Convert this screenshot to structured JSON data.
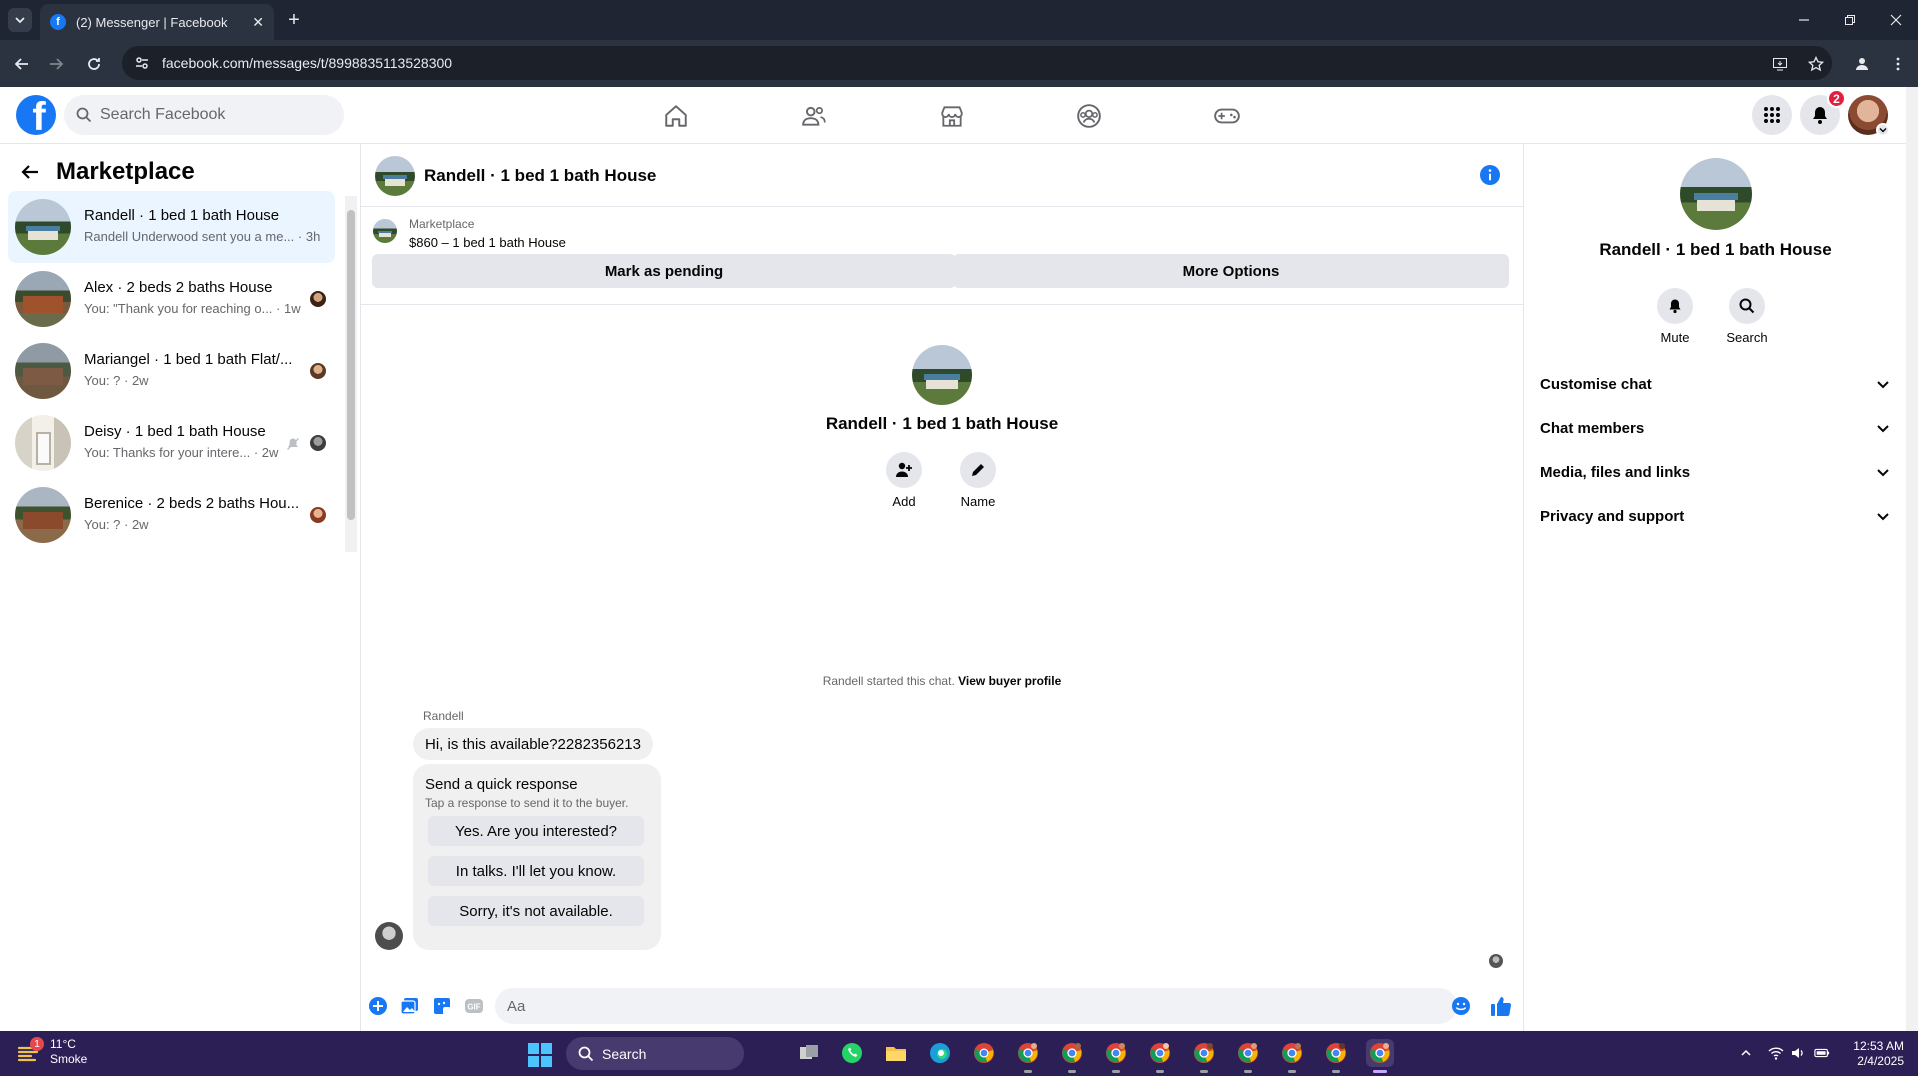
{
  "browser": {
    "tab_title": "(2) Messenger | Facebook",
    "url": "facebook.com/messages/t/8998835113528300"
  },
  "fb": {
    "search_placeholder": "Search Facebook",
    "notifications_count": "2",
    "brand_color": "#1877f2"
  },
  "left": {
    "title": "Marketplace",
    "conversations": [
      {
        "title": "Randell · 1 bed 1 bath House",
        "subtitle": "Randell Underwood sent you a me... · 3h"
      },
      {
        "title": "Alex · 2 beds 2 baths House",
        "subtitle": "You: \"Thank you for reaching o... · 1w"
      },
      {
        "title": "Mariangel · 1 bed 1 bath Flat/...",
        "subtitle": "You: ? · 2w"
      },
      {
        "title": "Deisy · 1 bed 1 bath House",
        "subtitle": "You: Thanks for your intere... · 2w"
      },
      {
        "title": "Berenice · 2 beds 2 baths Hou...",
        "subtitle": "You: ? · 2w"
      }
    ]
  },
  "chat": {
    "title": "Randell · 1 bed 1 bath House",
    "marketplace_label": "Marketplace",
    "listing": "$860 – 1 bed 1 bath House",
    "mark_pending": "Mark as pending",
    "more_options": "More Options",
    "intro_name": "Randell · 1 bed 1 bath House",
    "add_label": "Add",
    "name_label": "Name",
    "started_text": "Randell started this chat.",
    "view_buyer_profile": "View buyer profile",
    "sender": "Randell",
    "message": "Hi, is this available?2282356213",
    "quick_title": "Send a quick response",
    "quick_sub": "Tap a response to send it to the buyer.",
    "quick_options": [
      "Yes. Are you interested?",
      "In talks. I'll let you know.",
      "Sorry, it's not available."
    ],
    "composer_placeholder": "Aa"
  },
  "right": {
    "name": "Randell · 1 bed 1 bath House",
    "mute": "Mute",
    "search": "Search",
    "sections": [
      "Customise chat",
      "Chat members",
      "Media, files and links",
      "Privacy and support"
    ]
  },
  "taskbar": {
    "temp": "11°C",
    "condition": "Smoke",
    "weather_badge": "1",
    "search": "Search",
    "time": "12:53 AM",
    "date": "2/4/2025"
  }
}
